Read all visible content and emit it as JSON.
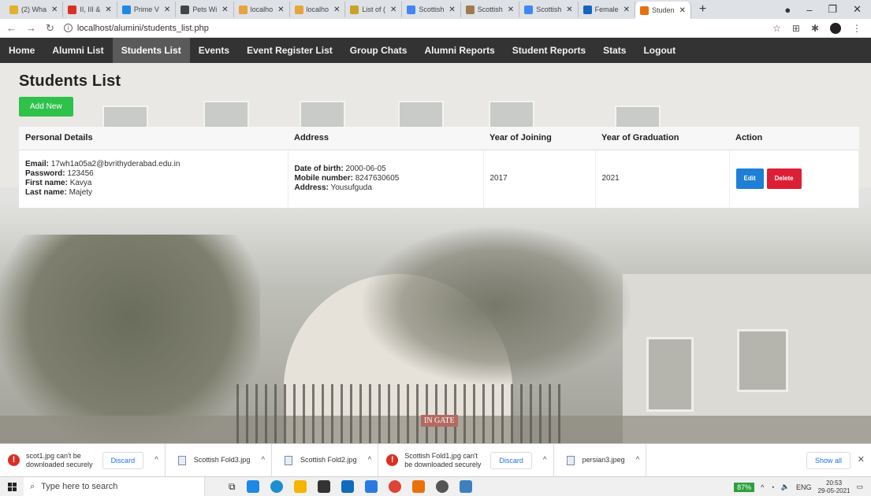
{
  "browser": {
    "tabs": [
      {
        "title": "(2) Wha",
        "color": "#e1b12c"
      },
      {
        "title": "II, III &",
        "color": "#d93025"
      },
      {
        "title": "Prime V",
        "color": "#1e88e5"
      },
      {
        "title": "Pets Wi",
        "color": "#444444"
      },
      {
        "title": "localho",
        "color": "#e8a33d"
      },
      {
        "title": "localho",
        "color": "#e8a33d"
      },
      {
        "title": "List of (",
        "color": "#c9a227"
      },
      {
        "title": "Scottish",
        "color": "#4285f4"
      },
      {
        "title": "Scottish",
        "color": "#9e7b4f"
      },
      {
        "title": "Scottish",
        "color": "#4285f4"
      },
      {
        "title": "Female",
        "color": "#1565c0"
      },
      {
        "title": "Studen",
        "color": "#e8710a"
      }
    ],
    "url": "localhost/alumini/students_list.php"
  },
  "nav": {
    "items": [
      "Home",
      "Alumni List",
      "Students List",
      "Events",
      "Event Register List",
      "Group Chats",
      "Alumni Reports",
      "Student Reports",
      "Stats",
      "Logout"
    ],
    "active": "Students List"
  },
  "page": {
    "title": "Students List",
    "add_button": "Add New"
  },
  "table": {
    "headers": [
      "Personal Details",
      "Address",
      "Year of Joining",
      "Year of Graduation",
      "Action"
    ],
    "rows": [
      {
        "email_label": "Email:",
        "email": "17wh1a05a2@bvrithyderabad.edu.in",
        "password_label": "Password:",
        "password": "123456",
        "first_name_label": "First name:",
        "first_name": "Kavya",
        "last_name_label": "Last name:",
        "last_name": "Majety",
        "dob_label": "Date of birth:",
        "dob": "2000-06-05",
        "mobile_label": "Mobile number:",
        "mobile": "8247630605",
        "address_label": "Address:",
        "address": "Yousufguda",
        "year_joining": "2017",
        "year_graduation": "2021",
        "edit_label": "Edit",
        "delete_label": "Delete"
      }
    ]
  },
  "background": {
    "gate_sign": "IN GATE"
  },
  "downloads": {
    "items": [
      {
        "text1": "scot1.jpg can't be",
        "text2": "downloaded securely",
        "warning": true,
        "discard": "Discard"
      },
      {
        "text1": "Scottish Fold3.jpg",
        "text2": "",
        "warning": false
      },
      {
        "text1": "Scottish Fold2.jpg",
        "text2": "",
        "warning": false
      },
      {
        "text1": "Scottish Fold1.jpg can't",
        "text2": "be downloaded securely",
        "warning": true,
        "discard": "Discard"
      },
      {
        "text1": "persian3.jpeg",
        "text2": "",
        "warning": false
      }
    ],
    "show_all": "Show all"
  },
  "taskbar": {
    "search_placeholder": "Type here to search",
    "battery": "87%",
    "language": "ENG",
    "time": "20:53",
    "date": "29-05-2021"
  }
}
